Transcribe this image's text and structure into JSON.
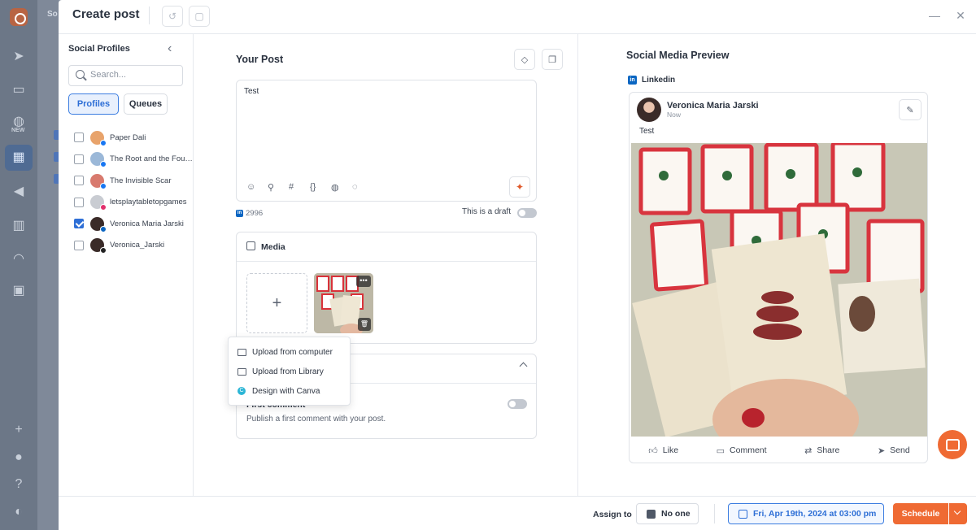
{
  "app": {
    "behind_text": "So",
    "rail_new_badge": "NEW"
  },
  "modal": {
    "title": "Create post"
  },
  "profiles_panel": {
    "title": "Social Profiles",
    "search_placeholder": "Search...",
    "tabs": [
      {
        "label": "Profiles",
        "active": true
      },
      {
        "label": "Queues",
        "active": false
      }
    ],
    "items": [
      {
        "name": "Paper Dali",
        "checked": false,
        "network": "facebook",
        "avatar_color": "#e8a36b"
      },
      {
        "name": "The Root and the Foun...",
        "checked": false,
        "network": "facebook",
        "avatar_color": "#9bb8d8"
      },
      {
        "name": "The Invisible Scar",
        "checked": false,
        "network": "facebook",
        "avatar_color": "#d87a6e"
      },
      {
        "name": "letsplaytabletopgames",
        "checked": false,
        "network": "instagram",
        "avatar_color": "#c9ccd2"
      },
      {
        "name": "Veronica Maria Jarski",
        "checked": true,
        "network": "linkedin",
        "avatar_color": "#3a2b28"
      },
      {
        "name": "Veronica_Jarski",
        "checked": false,
        "network": "threads",
        "avatar_color": "#3a2b28"
      }
    ]
  },
  "your_post": {
    "title": "Your Post",
    "text": "Test",
    "char_count": "2996",
    "draft_label": "This is a draft",
    "is_draft": false
  },
  "media": {
    "title": "Media",
    "add_symbol": "+",
    "thumb_more": "•••",
    "thumb_delete": "🗑",
    "menu": [
      {
        "label": "Upload from computer"
      },
      {
        "label": "Upload from Library"
      },
      {
        "label": "Design with Canva"
      }
    ],
    "canva_letter": "C"
  },
  "first_comment": {
    "title": "First comment",
    "description": "Publish a first comment with your post.",
    "enabled": false
  },
  "preview": {
    "title": "Social Media Preview",
    "network": "Linkedin",
    "author": "Veronica Maria Jarski",
    "time": "Now",
    "text": "Test",
    "actions": [
      "Like",
      "Comment",
      "Share",
      "Send"
    ]
  },
  "footer": {
    "assign_label": "Assign to",
    "assignee": "No one",
    "date": "Fri, Apr 19th, 2024 at 03:00 pm",
    "schedule_label": "Schedule"
  },
  "colors": {
    "accent_blue": "#2e6fd6",
    "accent_orange": "#ef6a33",
    "linkedin": "#0a66c2",
    "facebook": "#1877f2",
    "instagram": "#e1306c"
  }
}
